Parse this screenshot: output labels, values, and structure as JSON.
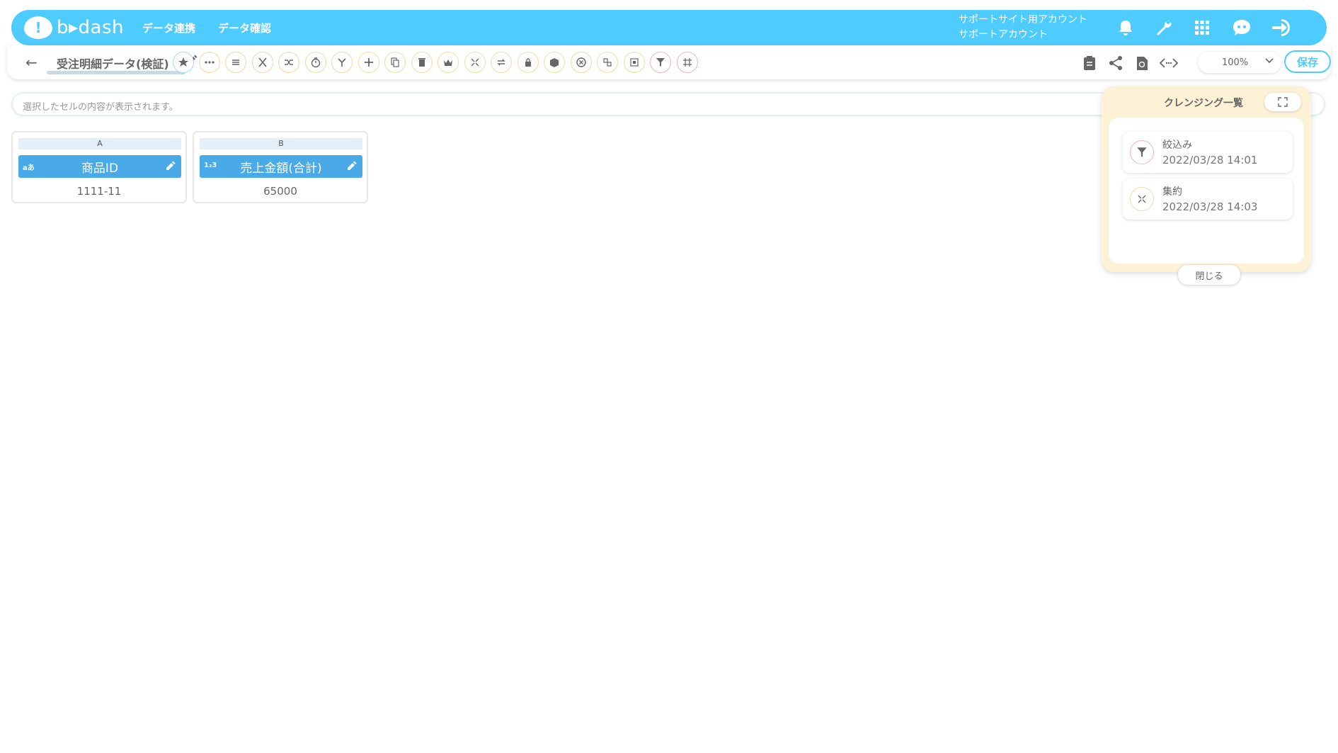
{
  "header": {
    "logo_text": "b▸dash",
    "nav": [
      "データ連携",
      "データ確認"
    ],
    "account_line1": "サポートサイト用アカウント",
    "account_line2": "サポートアカウント",
    "icons": [
      "bell-icon",
      "wrench-icon",
      "grid-icon",
      "robot-icon",
      "logout-icon"
    ]
  },
  "toolbar": {
    "back": "←",
    "title": "受注明細データ(検証)",
    "zoom_value": "100%",
    "save_label": "保存",
    "tools": [
      "star-icon",
      "dots-icon",
      "lines-icon",
      "scissors-icon",
      "merge-icon",
      "timer-icon",
      "branch-icon",
      "plus-icon",
      "copy-icon",
      "trash-icon",
      "crown-icon",
      "shrink-icon",
      "loop-icon",
      "lock-icon",
      "box-icon",
      "cancel-icon",
      "replace-icon",
      "frame-icon",
      "filter-icon",
      "hash-icon"
    ],
    "right_icons": [
      "clipboard-icon",
      "share-icon",
      "refresh-icon",
      "code-icon"
    ]
  },
  "cell_bar": {
    "placeholder": "選択したセルの内容が表示されます。"
  },
  "columns": [
    {
      "letter": "A",
      "type": "aあ",
      "name": "商品ID",
      "value": "1111-11"
    },
    {
      "letter": "B",
      "type": "1₂3",
      "name": "売上金額(合計)",
      "value": "65000"
    }
  ],
  "cleansing": {
    "title": "クレンジング一覧",
    "entries": [
      {
        "name": "絞込み",
        "date": "2022/03/28 14:01",
        "icon": "filter-icon"
      },
      {
        "name": "集約",
        "date": "2022/03/28 14:03",
        "icon": "aggregate-icon"
      }
    ],
    "close_label": "閉じる"
  }
}
